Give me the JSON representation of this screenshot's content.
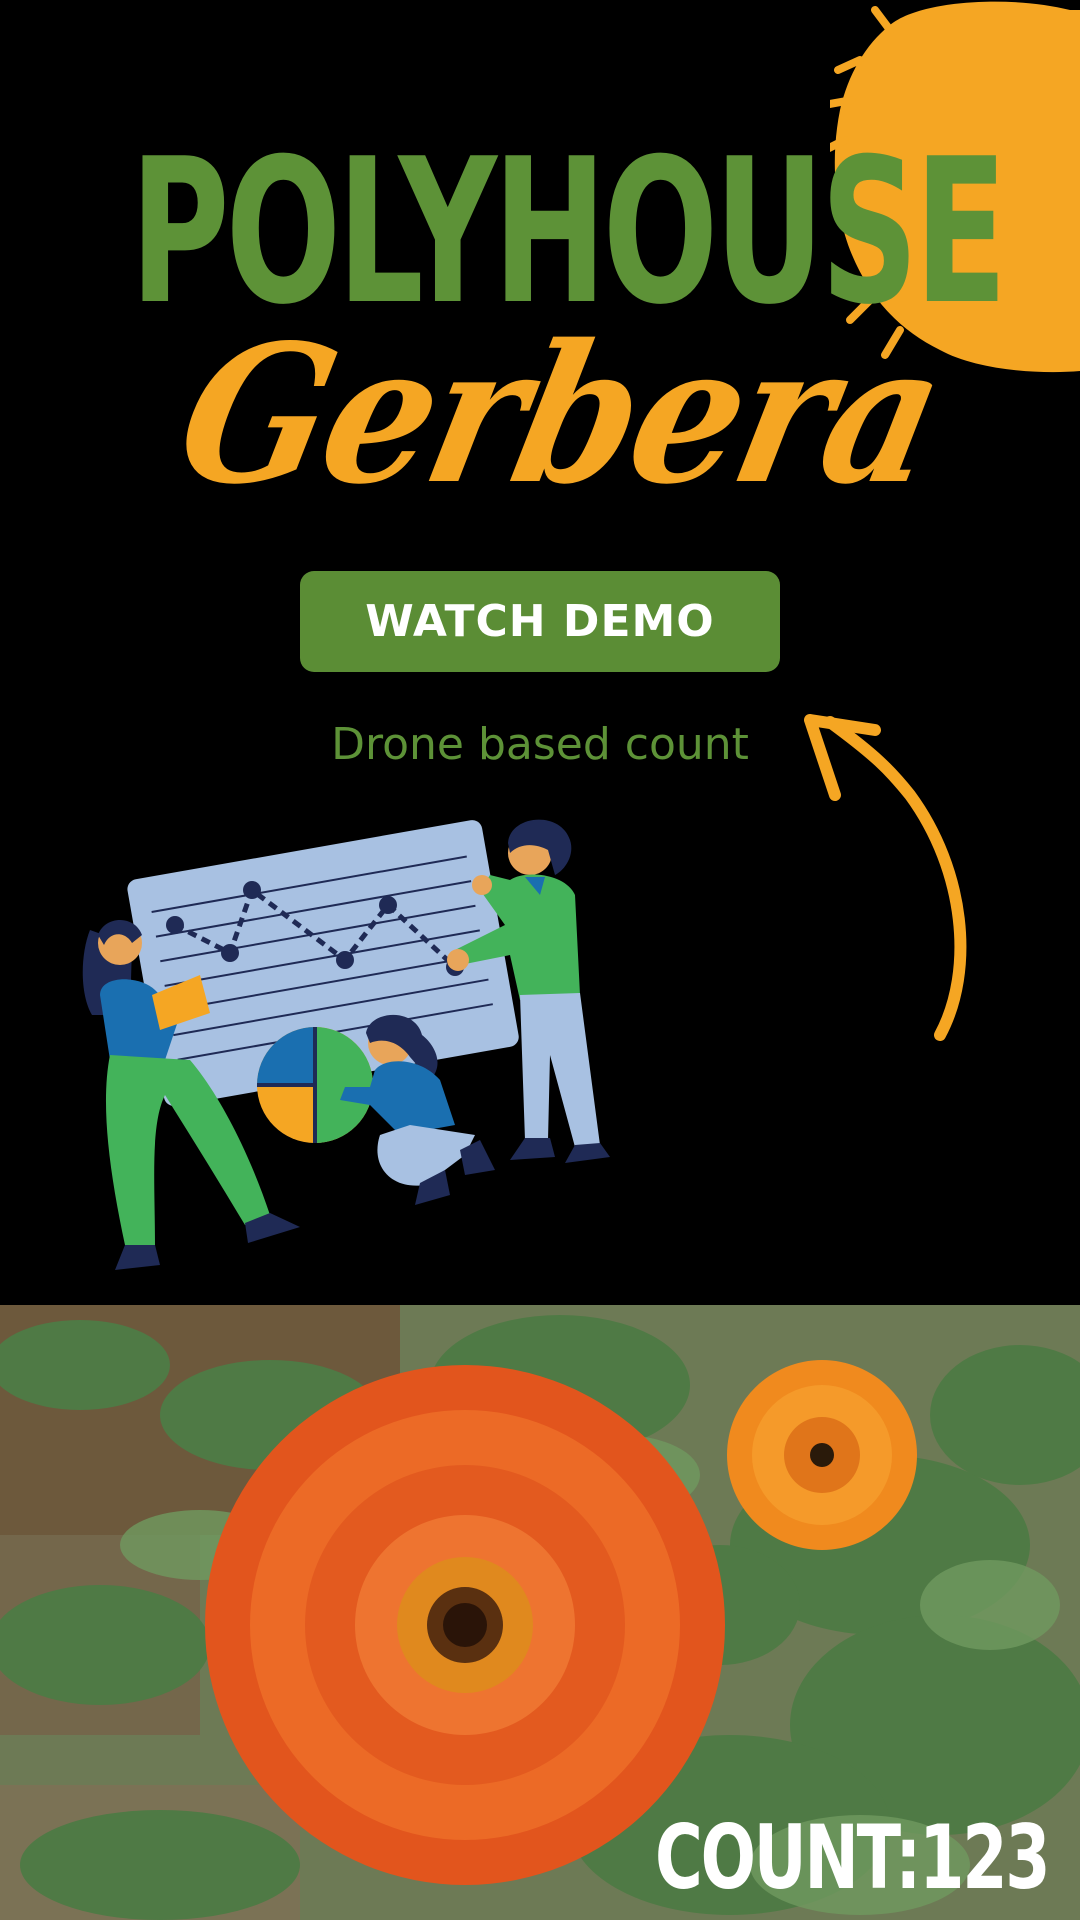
{
  "title": {
    "main": "POLYHOUSE",
    "script": "Gerbera"
  },
  "cta": {
    "label": "WATCH DEMO"
  },
  "subtitle": "Drone based count",
  "photo": {
    "count_label": "COUNT:123"
  },
  "illustration": {
    "icon": "data-analysis-team-illustration"
  },
  "colors": {
    "background": "#000000",
    "brand_green": "#5d9237",
    "accent_orange": "#f5a623",
    "flower_orange": "#e8601c"
  }
}
